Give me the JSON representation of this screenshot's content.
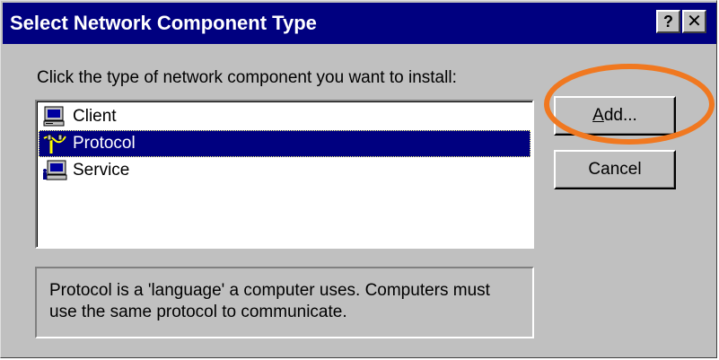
{
  "window": {
    "title": "Select Network Component Type",
    "help_glyph": "?",
    "close_glyph": "✕"
  },
  "prompt": "Click the type of network component you want to install:",
  "list": {
    "items": [
      {
        "label": "Client",
        "icon": "client-computer-icon",
        "selected": false
      },
      {
        "label": "Protocol",
        "icon": "protocol-cable-icon",
        "selected": true
      },
      {
        "label": "Service",
        "icon": "service-computer-icon",
        "selected": false
      }
    ]
  },
  "description": "Protocol is a 'language' a computer uses. Computers must use the same protocol to communicate.",
  "buttons": {
    "add_prefix": "A",
    "add_rest": "dd...",
    "cancel": "Cancel"
  },
  "colors": {
    "titlebar": "#000080",
    "face": "#c0c0c0",
    "selection": "#000080",
    "highlight_ellipse": "#f07820"
  }
}
